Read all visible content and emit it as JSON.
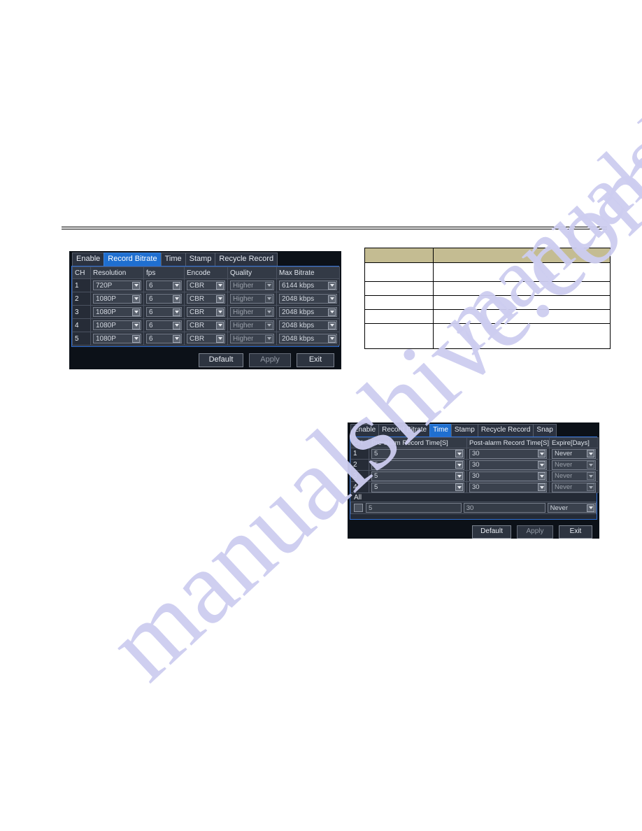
{
  "page": {
    "watermark": "manualshive.com",
    "rule_label": "horizontal-rule"
  },
  "dialog_record_bitrate": {
    "tabs": [
      {
        "label": "Enable",
        "selected": false
      },
      {
        "label": "Record Bitrate",
        "selected": true
      },
      {
        "label": "Time",
        "selected": false
      },
      {
        "label": "Stamp",
        "selected": false
      },
      {
        "label": "Recycle Record",
        "selected": false
      }
    ],
    "columns": [
      "CH",
      "Resolution",
      "fps",
      "Encode",
      "Quality",
      "Max Bitrate"
    ],
    "rows": [
      {
        "ch": "1",
        "resolution": "720P",
        "fps": "6",
        "encode": "CBR",
        "quality": "Higher",
        "max_bitrate": "6144 kbps"
      },
      {
        "ch": "2",
        "resolution": "1080P",
        "fps": "6",
        "encode": "CBR",
        "quality": "Higher",
        "max_bitrate": "2048 kbps"
      },
      {
        "ch": "3",
        "resolution": "1080P",
        "fps": "6",
        "encode": "CBR",
        "quality": "Higher",
        "max_bitrate": "2048 kbps"
      },
      {
        "ch": "4",
        "resolution": "1080P",
        "fps": "6",
        "encode": "CBR",
        "quality": "Higher",
        "max_bitrate": "2048 kbps"
      },
      {
        "ch": "5",
        "resolution": "1080P",
        "fps": "6",
        "encode": "CBR",
        "quality": "Higher",
        "max_bitrate": "2048 kbps"
      }
    ],
    "buttons": {
      "default": "Default",
      "apply": "Apply",
      "exit": "Exit"
    }
  },
  "dialog_time": {
    "tabs": [
      {
        "label": "Enable",
        "selected": false
      },
      {
        "label": "Record Bitrate",
        "selected": false
      },
      {
        "label": "Time",
        "selected": true
      },
      {
        "label": "Stamp",
        "selected": false
      },
      {
        "label": "Recycle Record",
        "selected": false
      },
      {
        "label": "Snap",
        "selected": false
      }
    ],
    "columns": [
      "CH",
      "Pre-alarm Record Time[S]",
      "Post-alarm Record Time[S]",
      "Expire[Days]"
    ],
    "rows": [
      {
        "ch": "1",
        "pre": "5",
        "post": "30",
        "expire": "Never"
      },
      {
        "ch": "2",
        "pre": "5",
        "post": "30",
        "expire": "Never"
      },
      {
        "ch": "3",
        "pre": "5",
        "post": "30",
        "expire": "Never"
      },
      {
        "ch": "4",
        "pre": "5",
        "post": "30",
        "expire": "Never"
      }
    ],
    "all_label": "All",
    "all_row": {
      "pre": "5",
      "post": "30",
      "expire": "Never"
    },
    "buttons": {
      "default": "Default",
      "apply": "Apply",
      "exit": "Exit"
    }
  },
  "doc_table": {
    "header": [
      "",
      ""
    ],
    "rows": [
      [
        "",
        ""
      ],
      [
        "",
        ""
      ],
      [
        "",
        ""
      ],
      [
        "",
        ""
      ],
      [
        "",
        ""
      ]
    ]
  }
}
